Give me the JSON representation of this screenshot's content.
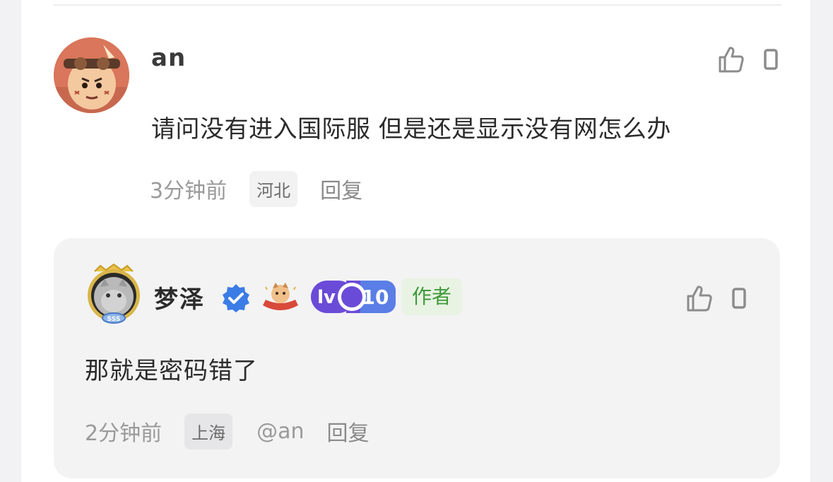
{
  "main_comment": {
    "username": "an",
    "text": "请问没有进入国际服 但是还是显示没有网怎么办",
    "time": "3分钟前",
    "region": "河北",
    "reply_label": "回复",
    "avatar_icon": "cartoon-avatar",
    "actions": [
      "thumb-up-icon",
      "dislike-icon"
    ]
  },
  "reply_comment": {
    "username": "梦泽",
    "verified_icon": "verified-check-icon",
    "event_badge_icon": "event-badge-icon",
    "level_prefix": "lv",
    "level": "10",
    "author_tag": "作者",
    "text": "那就是密码错了",
    "time": "2分钟前",
    "region": "上海",
    "mention": "@an",
    "reply_label": "回复",
    "avatar_icon": "cat-avatar-with-frame",
    "actions": [
      "thumb-up-icon",
      "dislike-icon"
    ]
  },
  "colors": {
    "verified_blue": "#3b7ce6",
    "level_purple": "#6a4bd8",
    "author_green": "#3f9a3a",
    "reply_bg": "#f3f3f4"
  }
}
